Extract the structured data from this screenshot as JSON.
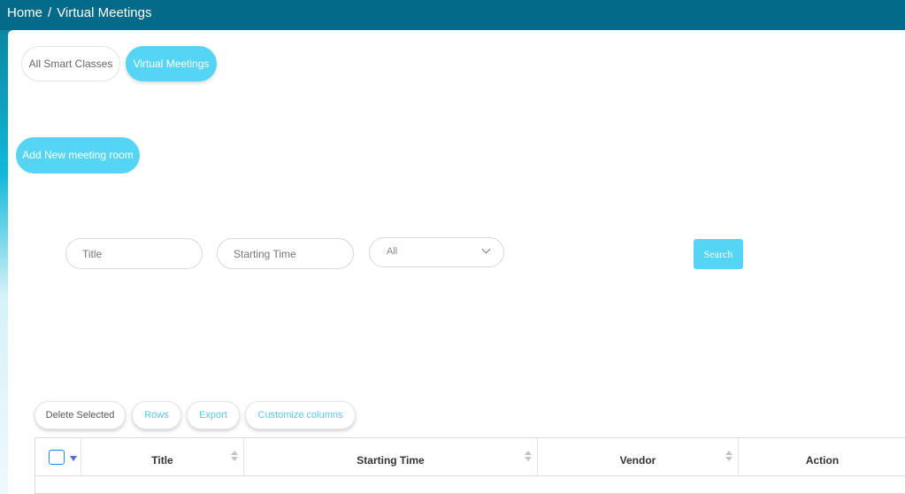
{
  "breadcrumb": {
    "home": "Home",
    "separator": "/",
    "current": "Virtual Meetings"
  },
  "tabs": [
    {
      "label": "All Smart Classes",
      "active": false
    },
    {
      "label": "Virtual Meetings",
      "active": true
    }
  ],
  "add_button": {
    "label": "Add New meeting room"
  },
  "filters": {
    "title_placeholder": "Title",
    "starting_time_placeholder": "Starting Time",
    "vendor_select": {
      "selected": "All"
    },
    "search_label": "Search"
  },
  "table_toolbar": {
    "delete_selected": "Delete Selected",
    "rows": "Rows",
    "export": "Export",
    "customize_columns": "Customize columns"
  },
  "table": {
    "columns": [
      "Title",
      "Starting Time",
      "Vendor",
      "Action"
    ]
  },
  "colors": {
    "topbar": "#046a89",
    "accent": "#55d5f3",
    "checkbox": "#2f86d6"
  },
  "icons": {
    "select_caret": "chevron-down-icon",
    "sort": "sort-icon",
    "checkbox_menu": "caret-down-icon"
  }
}
